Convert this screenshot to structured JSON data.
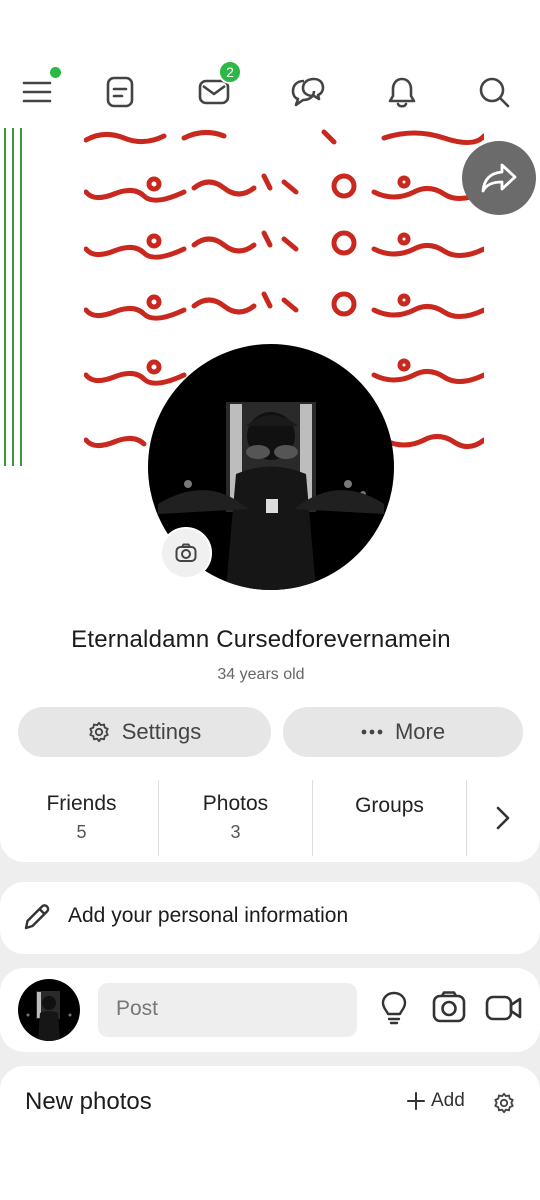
{
  "header": {
    "menu_icon": "hamburger-menu-icon",
    "notes_icon": "feed-icon",
    "messages_icon": "mail-icon",
    "messages_badge": "2",
    "chat_icon": "chat-bubbles-icon",
    "notifications_icon": "bell-icon",
    "search_icon": "search-icon",
    "accent_color": "#2cb845"
  },
  "profile": {
    "name": "Eternaldamn Cursedforevernamein",
    "age": "34 years old"
  },
  "actions": {
    "settings_label": "Settings",
    "more_label": "More"
  },
  "stats": [
    {
      "label": "Friends",
      "count": "5"
    },
    {
      "label": "Photos",
      "count": "3"
    },
    {
      "label": "Groups",
      "count": ""
    }
  ],
  "info": {
    "add_info_label": "Add your personal information"
  },
  "composer": {
    "placeholder": "Post"
  },
  "photos": {
    "title": "New photos",
    "add_label": "Add"
  }
}
